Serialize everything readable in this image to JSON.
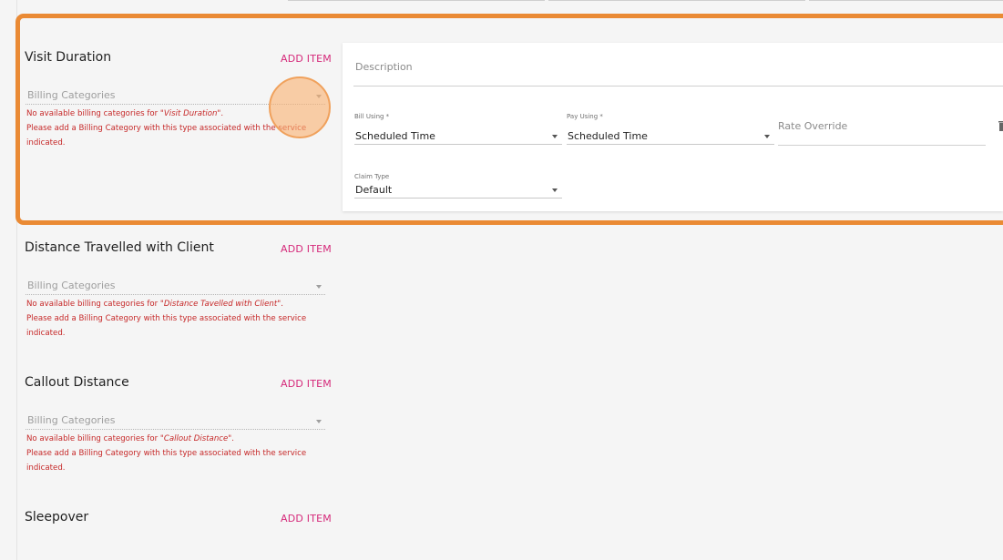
{
  "sections": [
    {
      "title": "Visit Duration",
      "add_item_label": "ADD ITEM",
      "billing_placeholder": "Billing Categories",
      "error_prefix": "No available billing categories for ",
      "error_service": "\"Visit Duration\"",
      "error_suffix": ".",
      "error_line2": "Please add a Billing Category with this type associated with the service indicated."
    },
    {
      "title": "Distance Travelled with Client",
      "add_item_label": "ADD ITEM",
      "billing_placeholder": "Billing Categories",
      "error_prefix": "No available billing categories for ",
      "error_service": "\"Distance Tavelled with Client\"",
      "error_suffix": ".",
      "error_line2": "Please add a Billing Category with this type associated with the service indicated."
    },
    {
      "title": "Callout Distance",
      "add_item_label": "ADD ITEM",
      "billing_placeholder": "Billing Categories",
      "error_prefix": "No available billing categories for ",
      "error_service": "\"Callout Distance\"",
      "error_suffix": ".",
      "error_line2": "Please add a Billing Category with this type associated with the service indicated."
    },
    {
      "title": "Sleepover",
      "add_item_label": "ADD ITEM"
    }
  ],
  "detail": {
    "description_placeholder": "Description",
    "bill_using": {
      "label": "Bill Using *",
      "value": "Scheduled Time"
    },
    "pay_using": {
      "label": "Pay Using *",
      "value": "Scheduled Time"
    },
    "rate_override_placeholder": "Rate Override",
    "claim_type": {
      "label": "Claim Type",
      "value": "Default"
    }
  },
  "colors": {
    "accent_pink": "#d5297a",
    "error_red": "#c62828",
    "highlight_orange": "#ea8a34"
  }
}
